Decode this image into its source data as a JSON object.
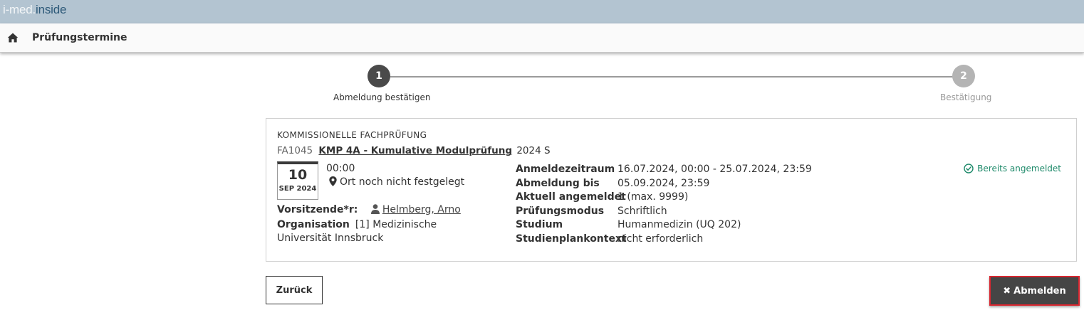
{
  "brand": {
    "part1": "i-med.",
    "part2": "inside"
  },
  "header": {
    "title": "Prüfungstermine",
    "home_icon": "home-icon"
  },
  "stepper": {
    "steps": [
      {
        "number": "1",
        "label": "Abmeldung bestätigen",
        "state": "active"
      },
      {
        "number": "2",
        "label": "Bestätigung",
        "state": "inactive"
      }
    ]
  },
  "exam": {
    "type": "KOMMISSIONELLE FACHPRÜFUNG",
    "code": "FA1045",
    "name": "KMP 4A - Kumulative Modulprüfung",
    "semester": "2024 S",
    "date": {
      "day": "10",
      "month_year": "SEP 2024"
    },
    "time": "00:00",
    "location": "Ort noch nicht festgelegt",
    "chair": {
      "label": "Vorsitzende*r:",
      "name": "Helmberg, Arno"
    },
    "organisation": {
      "label": "Organisation",
      "value": "[1] Medizinische Universität Innsbruck"
    },
    "details": [
      {
        "label": "Anmeldezeitraum",
        "value": "16.07.2024, 00:00 - 25.07.2024, 23:59"
      },
      {
        "label": "Abmeldung bis",
        "value": "05.09.2024, 23:59"
      },
      {
        "label": "Aktuell angemeldet",
        "value": "1 (max. 9999)"
      },
      {
        "label": "Prüfungsmodus",
        "value": "Schriftlich"
      },
      {
        "label": "Studium",
        "value": "Humanmedizin (UQ 202)"
      },
      {
        "label": "Studienplankontext",
        "value": "nicht erforderlich"
      }
    ],
    "status": "Bereits angemeldet"
  },
  "actions": {
    "back_label": "Zurück",
    "deregister_label": "Abmelden"
  },
  "colors": {
    "topbar": "#b3c4d1",
    "status_green": "#1e8a6a",
    "primary_button": "#454545",
    "highlight_border": "#d8262f"
  }
}
